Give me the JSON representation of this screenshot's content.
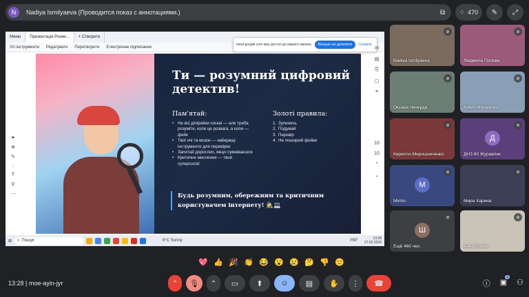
{
  "meeting": {
    "presenter_initial": "N",
    "presenter_label": "Nadiya Ismilyaeva (Проводится показ с аннотациями.)",
    "participant_count": "470",
    "time": "13:28",
    "code": "moe-ayin-jyr"
  },
  "share": {
    "tabs": [
      "Меню",
      "Презентація Power...",
      "+ Створити"
    ],
    "menu": [
      "Усі інструменти",
      "Редагувати",
      "Перетворити",
      "Електронне підписання"
    ],
    "notif_text": "meet.google.com має доступ до вашого екрана.",
    "notif_button": "Більше не ділитися",
    "notif_hide": "Сховати",
    "slide": {
      "title": "Ти — розумний цифровий детектив!",
      "left_heading": "Пам'ятай:",
      "left_items": [
        "Не всі діпфейки погані — але треба розуміти, коли це розвага, а коли — фейк",
        "Твої очі та мозок — найкращі інструменти для перевірки",
        "Запитай дорослих, якщо сумніваєшся",
        "Критичне мислення — твоя суперсила!"
      ],
      "right_heading": "Золоті правила:",
      "right_items": [
        "Зупинись",
        "Подумай",
        "Перевір",
        "Не поширюй фейки"
      ],
      "right_numbers": [
        "1.",
        "2.",
        "3.",
        "4."
      ],
      "callout": "Будь розумним, обережним та критичним користувачем інтернету! 🕵️💻"
    },
    "rail_numbers": [
      "10",
      "10"
    ],
    "taskbar": {
      "search": "Пошук",
      "weather": "6°C Sunny",
      "lang": "УКР",
      "time": "13:28",
      "date": "27.02.2026"
    }
  },
  "tiles": [
    {
      "name": "Nadiya Ismilyaeva",
      "bg": "#7b6a5e"
    },
    {
      "name": "Людмила Попова",
      "bg": "#9c5b7b"
    },
    {
      "name": "Оксана Чечерда",
      "bg": "#6d7f74"
    },
    {
      "name": "Artem Moiseenko",
      "bg": "#8a9fb5"
    },
    {
      "name": "Кирилло Мирошниченко",
      "bg": "#7a3838"
    },
    {
      "name": "ДНЗ 60 Журавлик",
      "bg": "#5b3f7a",
      "initial": "Д",
      "circ": "#8e6bbf"
    },
    {
      "name": "Minho",
      "bg": "#3a4880",
      "initial": "M",
      "circ": "#5b6fc7"
    },
    {
      "name": "Мира Харина",
      "bg": "#3c3f55"
    },
    {
      "name": "Ещё 460 чел.",
      "bg": "#3c4043",
      "initial": "Ш",
      "circ": "#8d6e63"
    },
    {
      "name": "Анна Ярмак",
      "bg": "#c9c3b8"
    }
  ],
  "reactions": [
    "💖",
    "👍",
    "🎉",
    "👏",
    "😂",
    "😮",
    "😢",
    "🤔",
    "👎",
    "🙂"
  ],
  "icons": {
    "mic_off": "mic-off-icon",
    "camera": "camera-icon",
    "present": "present-icon",
    "emoji": "emoji-icon",
    "captions": "captions-icon",
    "hand": "raise-hand-icon",
    "more": "more-icon",
    "hangup": "hangup-icon",
    "info": "info-icon",
    "chat": "chat-icon",
    "people": "people-icon"
  },
  "chat_badge": "1"
}
